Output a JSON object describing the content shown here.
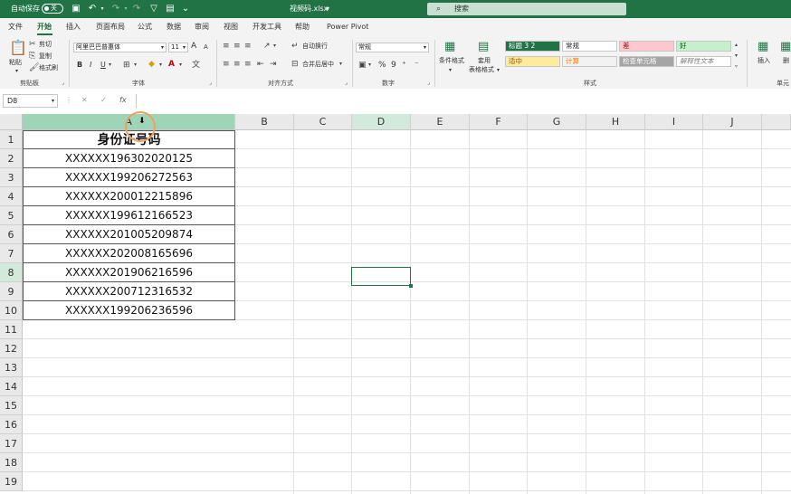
{
  "titlebar": {
    "autosave_label": "自动保存",
    "autosave_state": "关",
    "file_name": "视频码.xlsx",
    "file_menu_arrow": "▾",
    "search_placeholder": "搜索"
  },
  "tabs": [
    "文件",
    "开始",
    "插入",
    "页面布局",
    "公式",
    "数据",
    "审阅",
    "视图",
    "开发工具",
    "帮助",
    "Power Pivot"
  ],
  "active_tab": "开始",
  "ribbon": {
    "clipboard": {
      "paste": "粘贴",
      "cut": "剪切",
      "copy": "复制",
      "format_painter": "格式刷",
      "label": "剪贴板"
    },
    "font": {
      "font_name": "阿里巴巴普惠体",
      "font_size": "11",
      "label": "字体",
      "bold": "B",
      "italic": "I",
      "underline": "U",
      "grow": "A",
      "shrink": "A"
    },
    "alignment": {
      "wrap": "自动换行",
      "merge": "合并后居中",
      "label": "对齐方式"
    },
    "number": {
      "format": "常规",
      "label": "数字",
      "percent": "%",
      "comma": "9"
    },
    "styles": {
      "conditional": "条件格式",
      "table_format_line1": "套用",
      "table_format_line2": "表格格式",
      "cells": [
        {
          "text": "标题 3 2",
          "bg": "#217346",
          "color": "#ffffff"
        },
        {
          "text": "常规",
          "bg": "#ffffff",
          "color": "#222222"
        },
        {
          "text": "差",
          "bg": "#ffc7ce",
          "color": "#9c0006"
        },
        {
          "text": "好",
          "bg": "#c6efce",
          "color": "#006100"
        },
        {
          "text": "适中",
          "bg": "#ffeb9c",
          "color": "#9c5700"
        },
        {
          "text": "计算",
          "bg": "#f2f2f2",
          "color": "#fa7d00"
        },
        {
          "text": "检查单元格",
          "bg": "#a5a5a5",
          "color": "#ffffff"
        },
        {
          "text": "解释性文本",
          "bg": "#ffffff",
          "color": "#7f7f7f"
        }
      ],
      "label": "样式"
    },
    "cells": {
      "insert": "插入",
      "delete": "删",
      "label": "单元"
    }
  },
  "formula_bar": {
    "name_box": "D8",
    "cancel": "✕",
    "confirm": "✓",
    "fx": "fx",
    "content": ""
  },
  "columns": [
    "A",
    "B",
    "C",
    "D",
    "E",
    "F",
    "G",
    "H",
    "I",
    "J"
  ],
  "rows": [
    "1",
    "2",
    "3",
    "4",
    "5",
    "6",
    "7",
    "8",
    "9",
    "10",
    "11",
    "12",
    "13",
    "14",
    "15",
    "16",
    "17",
    "18",
    "19"
  ],
  "table": {
    "header": "身份证号码",
    "values": [
      "XXXXXX196302020125",
      "XXXXXX199206272563",
      "XXXXXX200012215896",
      "XXXXXX199612166523",
      "XXXXXX201005209874",
      "XXXXXX202008165696",
      "XXXXXX201906216596",
      "XXXXXX200712316532",
      "XXXXXX199206236596"
    ]
  }
}
